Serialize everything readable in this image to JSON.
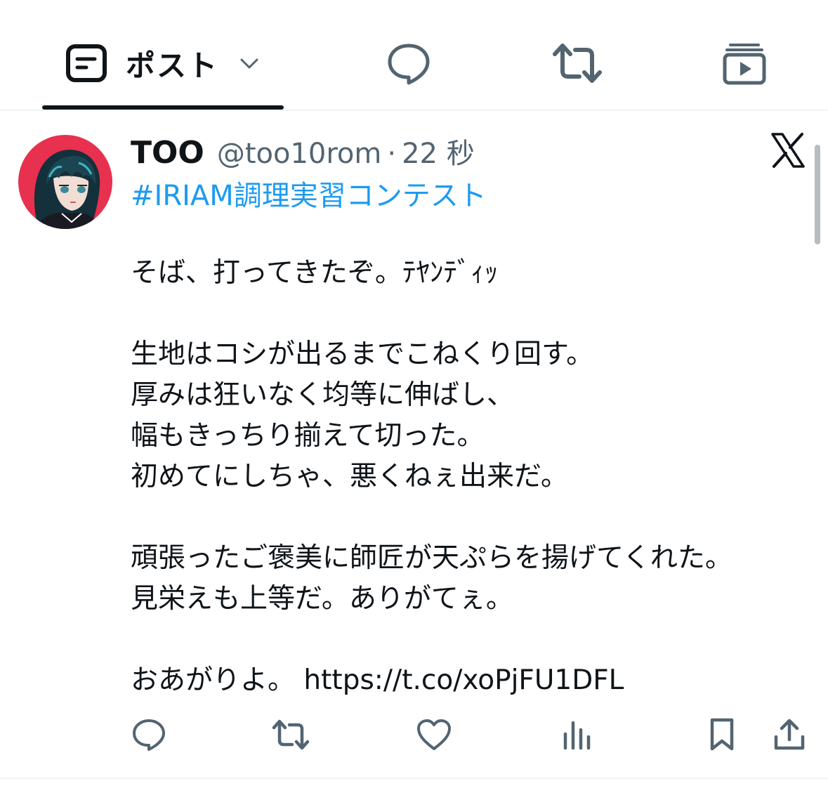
{
  "tabs": {
    "post_label": "ポスト",
    "items": [
      {
        "id": "post",
        "icon": "post-icon"
      },
      {
        "id": "reply",
        "icon": "reply-bubble-icon"
      },
      {
        "id": "repost",
        "icon": "repost-icon"
      },
      {
        "id": "media",
        "icon": "media-stack-play-icon"
      }
    ],
    "active": "post"
  },
  "tweet": {
    "display_name": "TOO",
    "handle": "@too10rom",
    "separator": "·",
    "timestamp": "22 秒",
    "hashtag": "#IRIAM調理実習コンテスト",
    "body": {
      "l1": "そば、打ってきたぞ。ﾃﾔﾝﾃﾞｨｯ",
      "l2": "生地はコシが出るまでこねくり回す。",
      "l3": "厚みは狂いなく均等に伸ばし、",
      "l4": "幅もきっちり揃えて切った。",
      "l5": "初めてにしちゃ、悪くねぇ出来だ。",
      "l6": "頑張ったご褒美に師匠が天ぷらを揚げてくれた。",
      "l7": "見栄えも上等だ。ありがてぇ。",
      "l8_text": "おあがりよ。 ",
      "l8_link": "https://t.co/xoPjFU1DFL"
    },
    "platform_icon": "x-logo-icon"
  },
  "actions": [
    {
      "id": "reply",
      "icon": "reply-icon"
    },
    {
      "id": "repost",
      "icon": "repost-icon"
    },
    {
      "id": "like",
      "icon": "heart-icon"
    },
    {
      "id": "views",
      "icon": "bar-chart-icon"
    },
    {
      "id": "bookmark",
      "icon": "bookmark-icon"
    },
    {
      "id": "share",
      "icon": "share-icon"
    }
  ],
  "colors": {
    "text": "#0f1419",
    "secondary": "#536471",
    "link": "#1d9bf0",
    "divider": "#eff3f4",
    "avatar_bg": "#e8304f"
  }
}
